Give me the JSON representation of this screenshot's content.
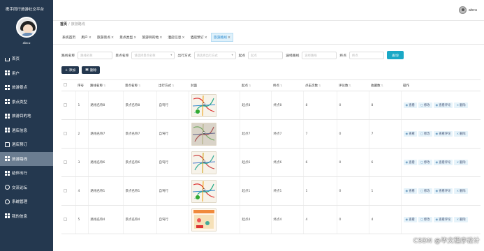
{
  "app": {
    "title": "携手同行旅游社交平台",
    "user": "abcu"
  },
  "sidebar": {
    "user": "abcu",
    "items": [
      {
        "label": "首页",
        "icon": "house-icon"
      },
      {
        "label": "用户",
        "icon": "grid-icon"
      },
      {
        "label": "旅游景点",
        "icon": "grid-icon"
      },
      {
        "label": "景点类型",
        "icon": "grid-icon"
      },
      {
        "label": "旅游目的地",
        "icon": "grid-icon"
      },
      {
        "label": "酒店信息",
        "icon": "grid-icon"
      },
      {
        "label": "酒店预订",
        "icon": "doc-icon"
      },
      {
        "label": "旅游路线",
        "icon": "grid-icon"
      },
      {
        "label": "结伴出行",
        "icon": "grid-icon"
      },
      {
        "label": "交流论坛",
        "icon": "dot-icon"
      },
      {
        "label": "系统管理",
        "icon": "dot-icon"
      },
      {
        "label": "我的信息",
        "icon": "grid-icon"
      }
    ],
    "active_index": 7
  },
  "topbar": {
    "user": "abcu"
  },
  "breadcrumb": {
    "home": "首页",
    "sep": "/",
    "current": "旅游路线"
  },
  "tabs": [
    {
      "label": "系统首页",
      "closable": false
    },
    {
      "label": "用户",
      "closable": true
    },
    {
      "label": "旅游景点",
      "closable": true
    },
    {
      "label": "景点类型",
      "closable": true
    },
    {
      "label": "旅游目的地",
      "closable": true
    },
    {
      "label": "酒店信息",
      "closable": true
    },
    {
      "label": "酒店预订",
      "closable": true
    },
    {
      "label": "旅游路线",
      "closable": true
    }
  ],
  "tab_close": "×",
  "active_tab": 7,
  "search": {
    "fields": [
      {
        "label": "路线名称",
        "placeholder": "路线名称",
        "width": 50,
        "select": false
      },
      {
        "label": "景点名称",
        "placeholder": "请选择景点名称",
        "width": 62,
        "select": true
      },
      {
        "label": "出行方式",
        "placeholder": "请选择出行方式",
        "width": 60,
        "select": true
      },
      {
        "label": "起点",
        "placeholder": "起点",
        "width": 50,
        "select": false
      },
      {
        "label": "途经路线",
        "placeholder": "途经路线",
        "width": 50,
        "select": false
      },
      {
        "label": "终点",
        "placeholder": "终点",
        "width": 50,
        "select": false
      }
    ],
    "button": "查询"
  },
  "actions": {
    "add": "+ 添加",
    "delete": "删除",
    "delete_icon": "trash-icon"
  },
  "table": {
    "columns": [
      "",
      "序号",
      "路线名称",
      "景点名称",
      "出行方式",
      "封面",
      "起点",
      "终点",
      "点击次数",
      "评论数",
      "收藏数",
      "操作"
    ],
    "sortable": [
      false,
      false,
      true,
      true,
      true,
      false,
      true,
      true,
      true,
      true,
      true,
      false
    ],
    "sort_glyph": "⇅",
    "rows": [
      {
        "no": "1",
        "route": "路线名称8",
        "spot": "景点名称8",
        "mode": "自驾行",
        "start": "起点8",
        "end": "终点8",
        "clicks": "8",
        "comments": "0",
        "favs": "8",
        "img": "map-a"
      },
      {
        "no": "2",
        "route": "路线名称7",
        "spot": "景点名称7",
        "mode": "自驾行",
        "start": "起点7",
        "end": "终点7",
        "clicks": "7",
        "comments": "0",
        "favs": "7",
        "img": "map-b"
      },
      {
        "no": "3",
        "route": "路线名称6",
        "spot": "景点名称6",
        "mode": "自驾行",
        "start": "起点6",
        "end": "终点6",
        "clicks": "6",
        "comments": "0",
        "favs": "6",
        "img": "map-c"
      },
      {
        "no": "4",
        "route": "路线名称1",
        "spot": "景点名称1",
        "mode": "自驾行",
        "start": "起点1",
        "end": "终点1",
        "clicks": "1",
        "comments": "0",
        "favs": "1",
        "img": "map-a"
      },
      {
        "no": "5",
        "route": "路线名称4",
        "spot": "景点名称4",
        "mode": "自驾行",
        "start": "起点4",
        "end": "终点4",
        "clicks": "4",
        "comments": "0",
        "favs": "4",
        "img": "map-d"
      }
    ],
    "ops": [
      {
        "label": "查看",
        "icon": "eye-icon",
        "glyph": "◉"
      },
      {
        "label": "修改",
        "icon": "doc-icon",
        "glyph": "▢"
      },
      {
        "label": "查看评论",
        "icon": "eye-icon",
        "glyph": "◉"
      },
      {
        "label": "删除",
        "icon": "close-icon",
        "glyph": "×"
      }
    ]
  },
  "watermark": "CSDN @毕文程序设计",
  "colors": {
    "sidebar": "#24384f",
    "active_menu": "#6b7d91",
    "search_btn": "#1aa8c6",
    "op_bg": "#e6f3fa"
  }
}
